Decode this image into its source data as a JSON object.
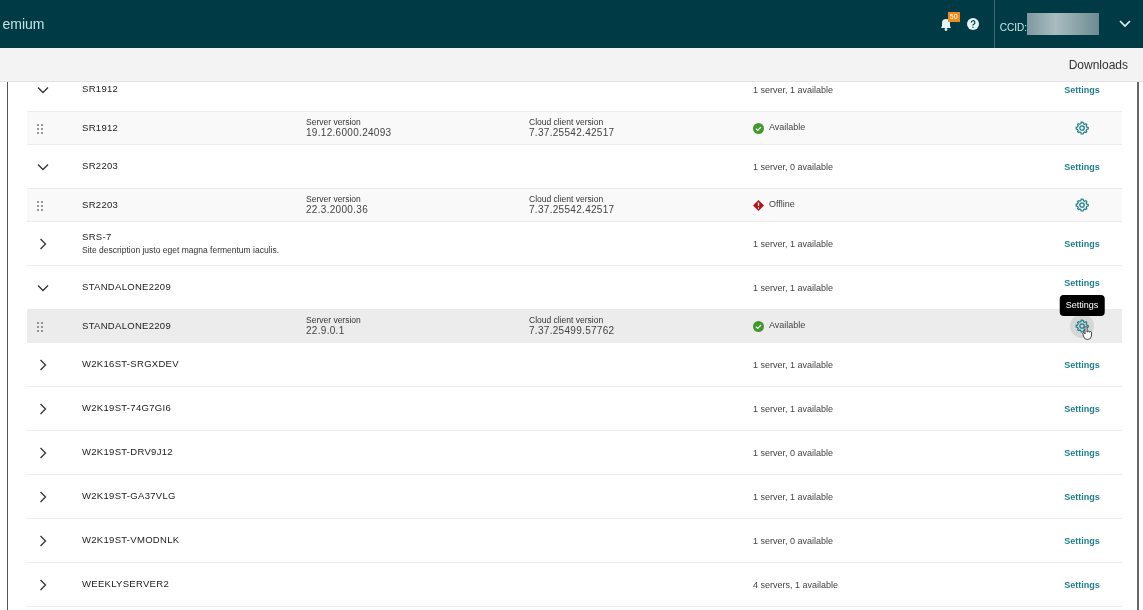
{
  "header": {
    "title": "emium",
    "notifications": {
      "count": "50"
    },
    "account_label": "CCID:"
  },
  "toolbar": {
    "downloads": "Downloads"
  },
  "sites": [
    {
      "name": "SR1912",
      "expanded": true,
      "summary": "1 server, 1 available",
      "action": "Settings",
      "servers": [
        {
          "name": "SR1912",
          "server_version_label": "Server version",
          "server_version": "19.12.6000.24093",
          "client_version_label": "Cloud client version",
          "client_version": "7.37.25542.42517",
          "status": "Available",
          "kind": "available",
          "hovered": false
        }
      ]
    },
    {
      "name": "SR2203",
      "expanded": true,
      "summary": "1 server, 0 available",
      "action": "Settings",
      "servers": [
        {
          "name": "SR2203",
          "server_version_label": "Server version",
          "server_version": "22.3.2000.36",
          "client_version_label": "Cloud client version",
          "client_version": "7.37.25542.42517",
          "status": "Offline",
          "kind": "offline",
          "hovered": false
        }
      ]
    },
    {
      "name": "SRS-7",
      "description": "Site description justo eget magna fermentum iaculis.",
      "expanded": false,
      "summary": "1 server, 1 available",
      "action": "Settings"
    },
    {
      "name": "STANDALONE2209",
      "expanded": true,
      "summary": "1 server, 1 available",
      "action": "Settings",
      "servers": [
        {
          "name": "STANDALONE2209",
          "server_version_label": "Server version",
          "server_version": "22.9.0.1",
          "client_version_label": "Cloud client version",
          "client_version": "7.37.25499.57762",
          "status": "Available",
          "kind": "available",
          "hovered": true,
          "tooltip": "Settings"
        }
      ]
    },
    {
      "name": "W2K16ST-SRGXDEV",
      "expanded": false,
      "summary": "1 server, 1 available",
      "action": "Settings"
    },
    {
      "name": "W2K19ST-74G7GI6",
      "expanded": false,
      "summary": "1 server, 1 available",
      "action": "Settings"
    },
    {
      "name": "W2K19ST-DRV9J12",
      "expanded": false,
      "summary": "1 server, 0 available",
      "action": "Settings"
    },
    {
      "name": "W2K19ST-GA37VLG",
      "expanded": false,
      "summary": "1 server, 1 available",
      "action": "Settings"
    },
    {
      "name": "W2K19ST-VMODNLK",
      "expanded": false,
      "summary": "1 server, 0 available",
      "action": "Settings"
    },
    {
      "name": "WEEKLYSERVER2",
      "expanded": false,
      "summary": "4 servers, 1 available",
      "action": "Settings"
    }
  ]
}
